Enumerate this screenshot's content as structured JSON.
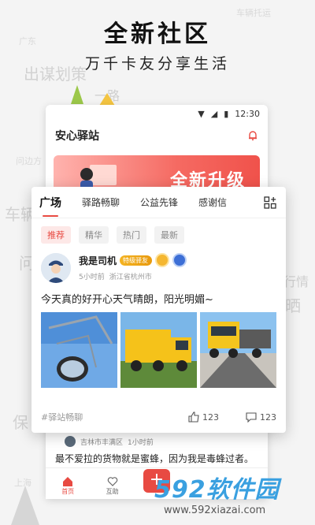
{
  "headline": "全新社区",
  "subline": "万千卡友分享生活",
  "background_words": [
    "广东",
    "出谋划策",
    "车辆",
    "问",
    "问边方",
    "保",
    "上海",
    "车辆托运",
    "一路",
    "行情",
    "晒"
  ],
  "status_bar": {
    "time": "12:30"
  },
  "app": {
    "title": "安心驿站",
    "banner_text": "全新升级"
  },
  "card": {
    "tabs": [
      {
        "label": "广场",
        "active": true
      },
      {
        "label": "驿路畅聊",
        "active": false
      },
      {
        "label": "公益先锋",
        "active": false
      },
      {
        "label": "感谢信",
        "active": false
      }
    ],
    "chips": [
      {
        "label": "推荐",
        "active": true
      },
      {
        "label": "精华",
        "active": false
      },
      {
        "label": "热门",
        "active": false
      },
      {
        "label": "最新",
        "active": false
      }
    ],
    "post": {
      "author": "我是司机",
      "badge": "特级驿友",
      "time_ago": "5小时前",
      "location": "浙江省杭州市",
      "text": "今天真的好开心天气晴朗，阳光明媚~",
      "topic": "#驿站畅聊",
      "likes": "123",
      "comments": "123"
    }
  },
  "feed2": {
    "location": "吉林市丰满区",
    "time_ago": "1小时前",
    "text": "最不爱拉的货物就是蜜蜂，因为我是毒蜂过者。"
  },
  "tabbar": [
    {
      "label": "首页",
      "active": true
    },
    {
      "label": "互助",
      "active": false
    }
  ],
  "watermark": {
    "brand": "592软件园",
    "url": "www.592xiazai.com"
  },
  "colors": {
    "accent": "#e84a42",
    "banner_start": "#ffb3ae",
    "banner_end": "#f0524b",
    "watermark": "#3aa0e0"
  }
}
